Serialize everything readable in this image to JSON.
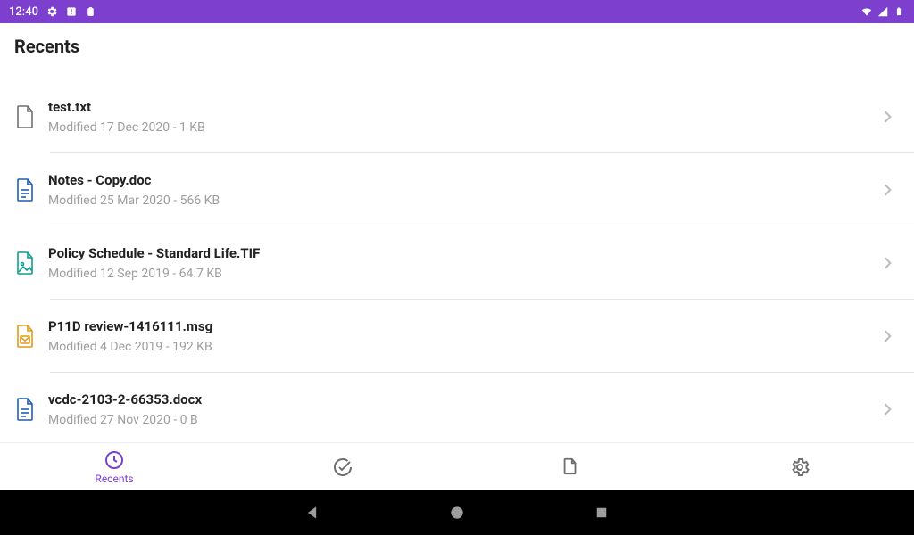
{
  "status_bar": {
    "time": "12:40"
  },
  "page": {
    "title": "Recents"
  },
  "files": [
    {
      "name": "test.txt",
      "meta": "Modified 17 Dec 2020 - 1 KB",
      "icon": "file-generic",
      "color": "#6f6f6f"
    },
    {
      "name": "Notes - Copy.doc",
      "meta": "Modified 25 Mar 2020 - 566 KB",
      "icon": "file-doc",
      "color": "#1e5fb3"
    },
    {
      "name": "Policy Schedule - Standard Life.TIF",
      "meta": "Modified 12 Sep 2019 - 64.7 KB",
      "icon": "file-image",
      "color": "#0e9e8f"
    },
    {
      "name": "P11D review-1416111.msg",
      "meta": "Modified 4 Dec 2019 - 192 KB",
      "icon": "file-msg",
      "color": "#e29a17"
    },
    {
      "name": "vcdc-2103-2-66353.docx",
      "meta": "Modified 27 Nov 2020 - 0 B",
      "icon": "file-doc",
      "color": "#1e5fb3"
    }
  ],
  "bottom_nav": {
    "items": [
      {
        "label": "Recents",
        "icon": "clock-icon",
        "active": true
      },
      {
        "label": "",
        "icon": "check-icon",
        "active": false
      },
      {
        "label": "",
        "icon": "file-icon",
        "active": false
      },
      {
        "label": "",
        "icon": "gear-icon",
        "active": false
      }
    ]
  },
  "colors": {
    "accent": "#7c3fce",
    "muted_text": "#9e9e9e"
  }
}
